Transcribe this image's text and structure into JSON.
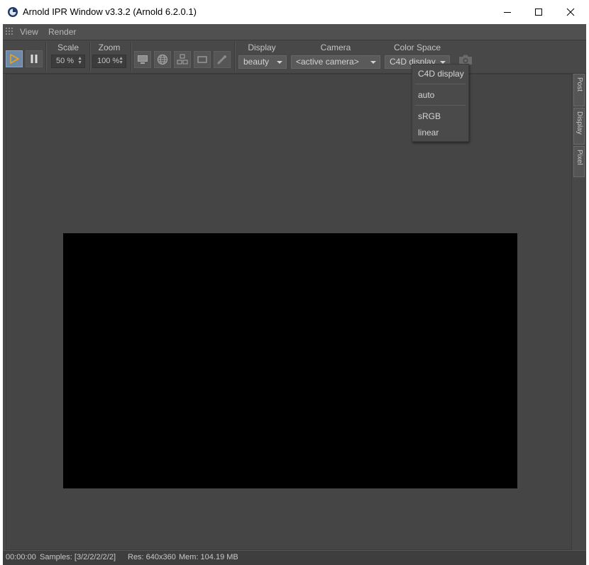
{
  "window": {
    "title": "Arnold IPR Window v3.3.2 (Arnold 6.2.0.1)"
  },
  "menubar": {
    "view": "View",
    "render": "Render"
  },
  "toolbar": {
    "scale": {
      "label": "Scale",
      "value": "50 %"
    },
    "zoom": {
      "label": "Zoom",
      "value": "100 %"
    },
    "display": {
      "label": "Display",
      "value": "beauty"
    },
    "camera": {
      "label": "Camera",
      "value": "<active camera>"
    },
    "colorspace": {
      "label": "Color Space",
      "value": "C4D display"
    }
  },
  "colorspace_menu": {
    "items": [
      "C4D display",
      "auto",
      "sRGB",
      "linear"
    ]
  },
  "side_tabs": [
    "Post",
    "Display",
    "Pixel"
  ],
  "status": {
    "time": "00:00:00",
    "samples": "Samples: [3/2/2/2/2/2]",
    "res": "Res: 640x360",
    "mem": "Mem: 104.19 MB"
  },
  "colors": {
    "accent": "#e8a317",
    "active_button": "#6e8aa8",
    "background": "#484848",
    "render": "#000000"
  }
}
